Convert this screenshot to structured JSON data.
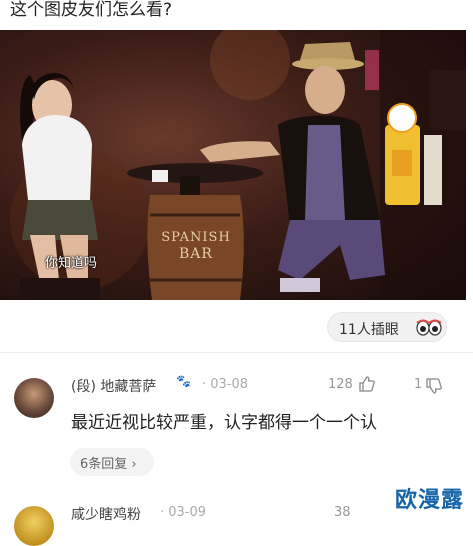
{
  "post": {
    "question": "这个图皮友们怎么看?"
  },
  "video": {
    "subtitle": "你知道吗",
    "barrel_text": [
      "SPANISH",
      "BAR"
    ]
  },
  "reactions": {
    "viewers_label": "11人插眼"
  },
  "comments": [
    {
      "username": "(段) 地藏菩萨",
      "date": "· 03-08",
      "likes": "128",
      "dislikes": "1",
      "text": "最近近视比较严重，认字都得一个一个认",
      "replies_label": "6条回复 ›"
    },
    {
      "username": "咸少瞎鸡粉",
      "date": "· 03-09",
      "likes": "38",
      "dislikes": "",
      "text": "",
      "replies_label": ""
    }
  ],
  "watermark": "欧漫露",
  "colors": {
    "watermark": "#1565a8",
    "stage_bg": "#3a1c16",
    "pill_bg": "#f1f1f1"
  }
}
